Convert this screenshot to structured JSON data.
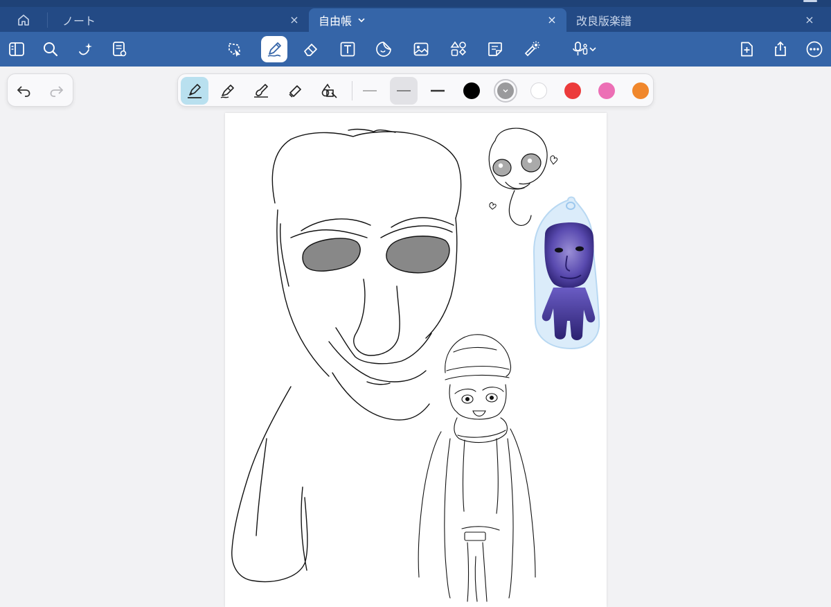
{
  "tabs": {
    "home_icon": "house-icon",
    "items": [
      {
        "label": "ノート"
      },
      {
        "label": "自由帳",
        "active": true
      },
      {
        "label": "改良版楽譜"
      }
    ],
    "close_glyph": "×"
  },
  "toolbar": {
    "left": [
      "sidebar-icon",
      "search-icon",
      "sparkle-icon",
      "document-view-icon"
    ],
    "center": [
      "lasso-icon",
      "pen-icon",
      "eraser-icon",
      "text-box-icon",
      "sticker-icon",
      "image-icon",
      "shapes-icon",
      "sticky-note-icon",
      "laser-pointer-icon",
      "microphone-icon"
    ],
    "right": [
      "add-page-icon",
      "share-icon",
      "more-icon"
    ],
    "active_tool": "pen-icon"
  },
  "pen_palette": {
    "pen_types": [
      "fountain-pen-icon",
      "ballpoint-pen-icon",
      "brush-pen-icon",
      "highlighter-icon",
      "shape-pen-icon"
    ],
    "active_pen": "fountain-pen-icon",
    "widths": [
      "thin",
      "medium",
      "thick"
    ],
    "active_width": "medium",
    "colors": [
      "#000000",
      "#9a9a9c",
      "#ffffff",
      "#ec3b3b",
      "#ec6fb5",
      "#f0872c"
    ],
    "selected_color": "#9a9a9c"
  },
  "accent": "#3565a8"
}
